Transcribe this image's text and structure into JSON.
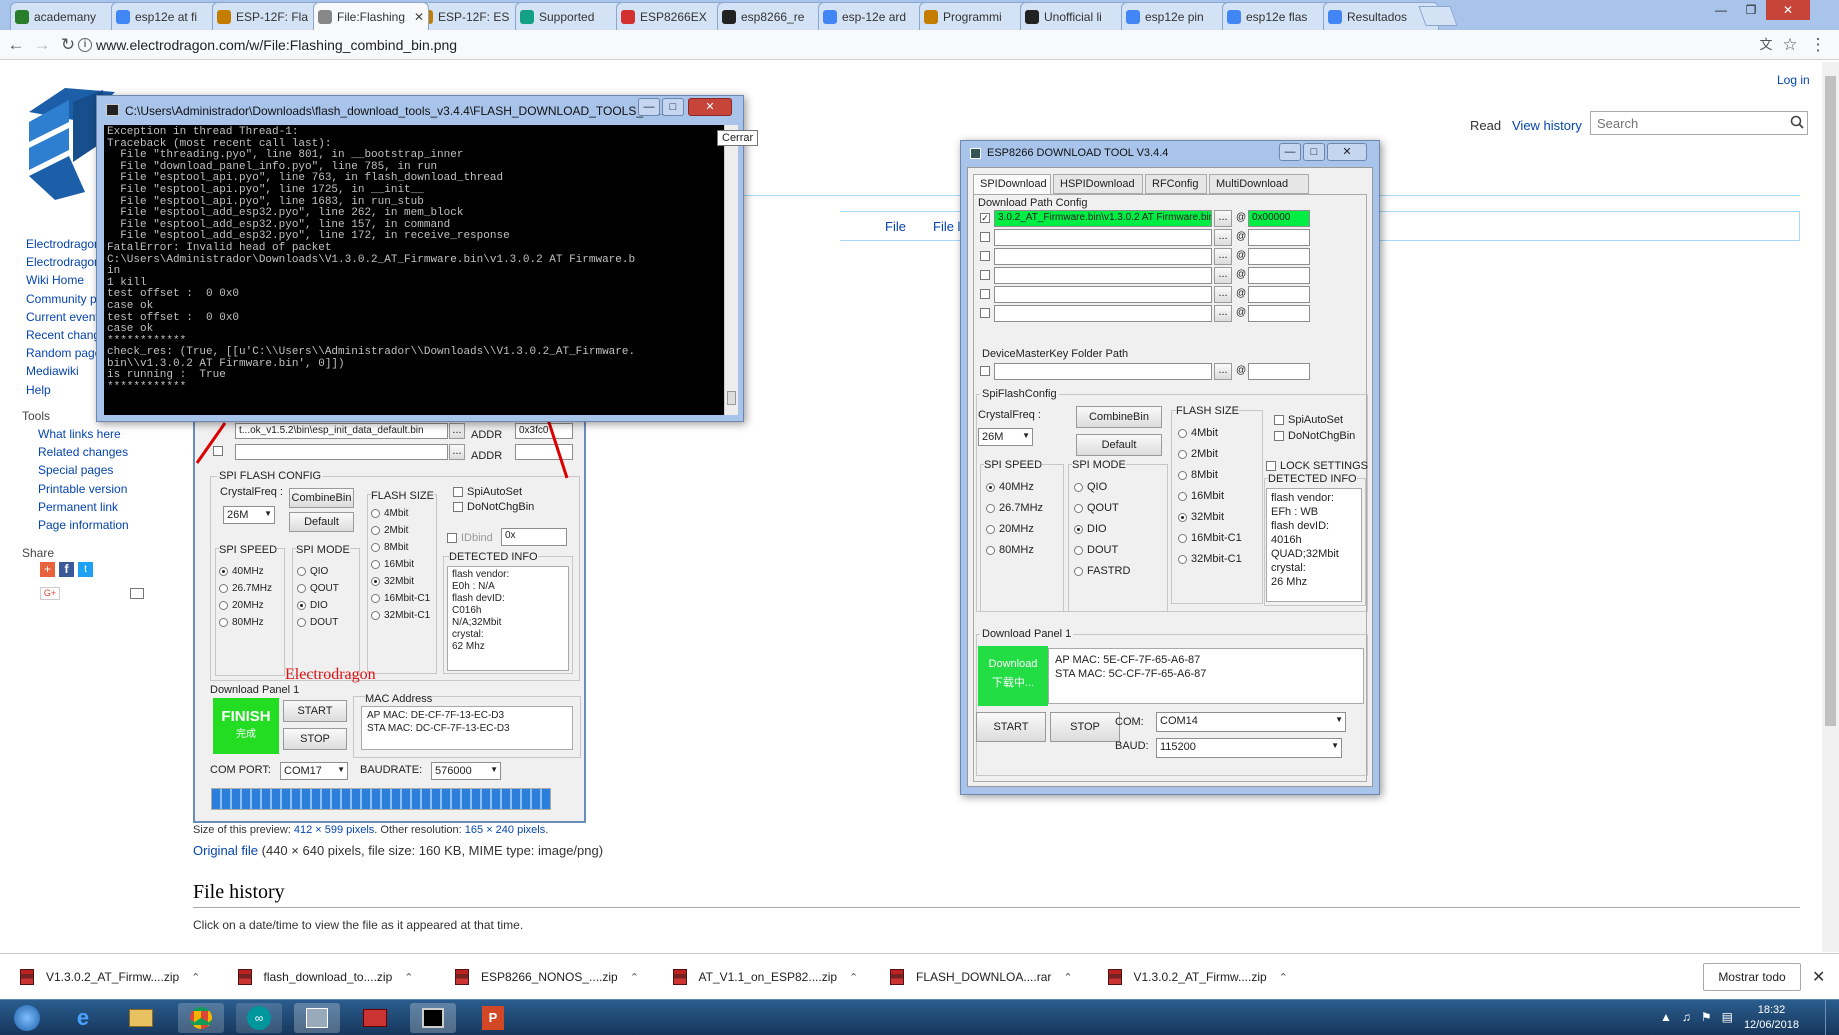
{
  "browser": {
    "tabs": [
      {
        "label": "academany",
        "color": "#2a7d2a"
      },
      {
        "label": "esp12e at fi",
        "color": "#4285f4"
      },
      {
        "label": "ESP-12F: Fla",
        "color": "#c47d00"
      },
      {
        "label": "File:Flashing",
        "color": "#888888"
      },
      {
        "label": "ESP-12F: ES",
        "color": "#c47d00"
      },
      {
        "label": "Supported",
        "color": "#14a085"
      },
      {
        "label": "ESP8266EX",
        "color": "#d32f2f"
      },
      {
        "label": "esp8266_re",
        "color": "#222222"
      },
      {
        "label": "esp-12e ard",
        "color": "#4285f4"
      },
      {
        "label": "Programmi",
        "color": "#c47d00"
      },
      {
        "label": "Unofficial li",
        "color": "#222222"
      },
      {
        "label": "esp12e pin",
        "color": "#4285f4"
      },
      {
        "label": "esp12e flas",
        "color": "#4285f4"
      },
      {
        "label": "Resultados",
        "color": "#4285f4"
      }
    ],
    "active_tab_index": 3,
    "url": "www.electrodragon.com/w/File:Flashing_combind_bin.png"
  },
  "wiki": {
    "login": "Log in",
    "read": "Read",
    "view_history": "View history",
    "search_placeholder": "Search",
    "nav_file": "File",
    "nav_file2": "File l",
    "sidebar_main": [
      "Electrodragon",
      "Electrodragon",
      "Wiki Home",
      "Community p",
      "Current event",
      "Recent chang",
      "Random page",
      "Mediawiki",
      "Help"
    ],
    "tools_heading": "Tools",
    "tools": [
      "What links here",
      "Related changes",
      "Special pages",
      "Printable version",
      "Permanent link",
      "Page information"
    ],
    "share_heading": "Share",
    "preview_prefix": "Size of this preview: ",
    "preview_link": "412 × 599 pixels",
    "preview_mid": ". Other resolution: ",
    "preview_link2": "165 × 240 pixels",
    "preview_end": ".",
    "original_link": "Original file",
    "original_rest": " (440 × 640 pixels, file size: 160 KB, MIME type: image/png)",
    "file_history_heading": "File history",
    "file_history_text": "Click on a date/time to view the file as it appeared at that time."
  },
  "console": {
    "title": "C:\\Users\\Administrador\\Downloads\\flash_download_tools_v3.4.4\\FLASH_DOWNLOAD_TOOLS_V3...",
    "tooltip": "Cerrar",
    "lines": [
      "Exception in thread Thread-1:",
      "Traceback (most recent call last):",
      "  File \"threading.pyo\", line 801, in __bootstrap_inner",
      "  File \"download_panel_info.pyo\", line 785, in run",
      "  File \"esptool_api.pyo\", line 763, in flash_download_thread",
      "  File \"esptool_api.pyo\", line 1725, in __init__",
      "  File \"esptool_api.pyo\", line 1683, in run_stub",
      "  File \"esptool_add_esp32.pyo\", line 262, in mem_block",
      "  File \"esptool_add_esp32.pyo\", line 157, in command",
      "  File \"esptool_add_esp32.pyo\", line 172, in receive_response",
      "FatalError: Invalid head of packet",
      "",
      "C:\\Users\\Administrador\\Downloads\\V1.3.0.2_AT_Firmware.bin\\v1.3.0.2 AT Firmware.b",
      "in",
      "1 kill",
      "test offset :  0 0x0",
      "case ok",
      "test offset :  0 0x0",
      "case ok",
      "************",
      "check_res: (True, [[u'C:\\\\Users\\\\Administrador\\\\Downloads\\\\V1.3.0.2_AT_Firmware.",
      "bin\\\\v1.3.0.2 AT Firmware.bin', 0]])",
      "is running :  True",
      "************"
    ]
  },
  "old_tool": {
    "path1": "t...ok_v1.5.2\\bin\\esp_init_data_default.bin",
    "addr_label": "ADDR",
    "addr1": "0x3fc0",
    "spi_flash_config": "SPI FLASH CONFIG",
    "crystal_label": "CrystalFreq :",
    "crystal_value": "26M",
    "combine": "CombineBin",
    "default": "Default",
    "flash_size": "FLASH SIZE",
    "flash_sizes": [
      "4Mbit",
      "2Mbit",
      "8Mbit",
      "16Mbit",
      "32Mbit",
      "16Mbit-C1",
      "32Mbit-C1"
    ],
    "flash_selected": 4,
    "spi_auto": "SpiAutoSet",
    "do_not_chg": "DoNotChgBin",
    "idbind": "IDbind",
    "idbind_value": "0x",
    "spi_speed": "SPI SPEED",
    "speeds": [
      "40MHz",
      "26.7MHz",
      "20MHz",
      "80MHz"
    ],
    "speed_selected": 0,
    "spi_mode": "SPI MODE",
    "modes": [
      "QIO",
      "QOUT",
      "DIO",
      "DOUT"
    ],
    "mode_selected": 2,
    "detected_info": "DETECTED INFO",
    "detected_lines": [
      "flash vendor:",
      "E0h : N/A",
      "flash devID:",
      "C016h",
      "N/A;32Mbit",
      "crystal:",
      "62 Mhz"
    ],
    "watermark": "Electrodragon",
    "download_panel": "Download Panel 1",
    "finish": "FINISH",
    "finish_cn": "完成",
    "start": "START",
    "stop": "STOP",
    "mac_address": "MAC Address",
    "ap_mac": "AP MAC:  DE-CF-7F-13-EC-D3",
    "sta_mac": "STA MAC:  DC-CF-7F-13-EC-D3",
    "com_port_label": "COM PORT:",
    "com_port": "COM17",
    "baudrate_label": "BAUDRATE:",
    "baudrate": "576000",
    "progress": 1.0
  },
  "esp_tool": {
    "title": "ESP8266 DOWNLOAD TOOL V3.4.4",
    "tabs": [
      "SPIDownload",
      "HSPIDownload",
      "RFConfig",
      "MultiDownload"
    ],
    "download_path_config": "Download Path Config",
    "path1": "3.0.2_AT_Firmware.bin\\v1.3.0.2 AT Firmware.bin",
    "offset1": "0x00000",
    "browse": "...",
    "at": "@",
    "device_master_key": "DeviceMasterKey Folder Path",
    "spi_flash_config": "SpiFlashConfig",
    "crystal_label": "CrystalFreq :",
    "crystal_value": "26M",
    "combine": "CombineBin",
    "default": "Default",
    "flash_size": "FLASH SIZE",
    "flash_sizes": [
      "4Mbit",
      "2Mbit",
      "8Mbit",
      "16Mbit",
      "32Mbit",
      "16Mbit-C1",
      "32Mbit-C1"
    ],
    "flash_selected": 4,
    "spi_auto": "SpiAutoSet",
    "do_not_chg": "DoNotChgBin",
    "lock_settings": "LOCK SETTINGS",
    "detected_info": "DETECTED INFO",
    "detected_lines": [
      "flash vendor:",
      "EFh : WB",
      "flash devID:",
      "4016h",
      "QUAD;32Mbit",
      "crystal:",
      "26 Mhz"
    ],
    "spi_speed": "SPI SPEED",
    "speeds": [
      "40MHz",
      "26.7MHz",
      "20MHz",
      "80MHz"
    ],
    "speed_selected": 0,
    "spi_mode": "SPI MODE",
    "modes": [
      "QIO",
      "QOUT",
      "DIO",
      "DOUT",
      "FASTRD"
    ],
    "mode_selected": 2,
    "download_panel": "Download Panel 1",
    "download_btn": "Download",
    "download_cn": "下载中...",
    "ap_mac": "AP MAC:  5E-CF-7F-65-A6-87",
    "sta_mac": "STA MAC:  5C-CF-7F-65-A6-87",
    "start": "START",
    "stop": "STOP",
    "com_label": "COM:",
    "com": "COM14",
    "baud_label": "BAUD:",
    "baud": "115200"
  },
  "downloads": {
    "items": [
      "V1.3.0.2_AT_Firmw....zip",
      "flash_download_to....zip",
      "ESP8266_NONOS_....zip",
      "AT_V1.1_on_ESP82....zip",
      "FLASH_DOWNLOA....rar",
      "V1.3.0.2_AT_Firmw....zip"
    ],
    "show_all": "Mostrar todo"
  },
  "taskbar": {
    "time": "18:32",
    "date": "12/06/2018"
  }
}
